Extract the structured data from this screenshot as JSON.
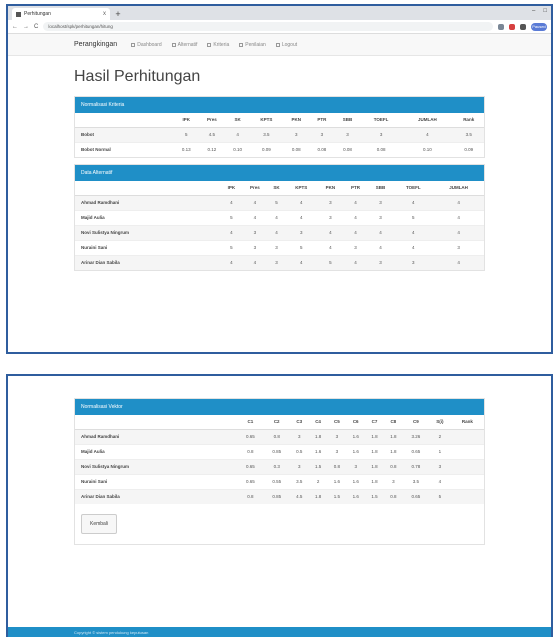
{
  "browser": {
    "tab_title": "Perhitungan",
    "tab_close": "x",
    "newtab": "+",
    "win_min": "–",
    "win_max": "□",
    "win_close": "×",
    "back": "←",
    "forward": "→",
    "reload": "C",
    "url": "localhost/spk/perhitungan/hitung",
    "profile": "Paused"
  },
  "nav": {
    "brand": "Perangkingan",
    "items": [
      "Dashboard",
      "Alternatif",
      "Kriteria",
      "Penilaian",
      "Logout"
    ]
  },
  "page_title": "Hasil Perhitungan",
  "table1": {
    "heading": "Normalisasi Kriteria",
    "columns": [
      "",
      "IPK",
      "Pres",
      "SK",
      "KPTS",
      "PKN",
      "PTR",
      "SBB",
      "TOEFL",
      "JUMLAH",
      "Rank"
    ],
    "rows": [
      [
        "Bobot",
        "5",
        "4.5",
        "4",
        "3.5",
        "3",
        "3",
        "3",
        "3",
        "4",
        "3.5"
      ],
      [
        "Bobot Normal",
        "0.13",
        "0.12",
        "0.10",
        "0.09",
        "0.08",
        "0.08",
        "0.08",
        "0.08",
        "0.10",
        "0.09"
      ]
    ]
  },
  "table2": {
    "heading": "Data Alternatif",
    "columns": [
      "",
      "IPK",
      "Pres",
      "SK",
      "KPTS",
      "PKN",
      "PTR",
      "SBB",
      "TOEFL",
      "JUMLAH"
    ],
    "rows": [
      [
        "Ahmad Ramdhani",
        "4",
        "4",
        "5",
        "4",
        "3",
        "4",
        "3",
        "4",
        "4"
      ],
      [
        "Majid Aulia",
        "5",
        "4",
        "4",
        "4",
        "3",
        "4",
        "3",
        "5",
        "4"
      ],
      [
        "Novi Sulistya Ningrum",
        "4",
        "3",
        "4",
        "3",
        "4",
        "4",
        "4",
        "4",
        "4"
      ],
      [
        "Nuraini Sani",
        "5",
        "3",
        "3",
        "5",
        "4",
        "3",
        "4",
        "4",
        "3"
      ],
      [
        "Arinar Dian Sabila",
        "4",
        "4",
        "3",
        "4",
        "5",
        "4",
        "3",
        "3",
        "4"
      ]
    ]
  },
  "table3": {
    "heading": "Normalisasi Vektor",
    "columns": [
      "",
      "C1",
      "C2",
      "C3",
      "C4",
      "C5",
      "C6",
      "C7",
      "C8",
      "C9",
      "S(i)",
      "Rank"
    ],
    "rows": [
      [
        "Ahmad Ramdhani",
        "0.65",
        "0.8",
        "3",
        "1.8",
        "3",
        "1.6",
        "1.8",
        "1.8",
        "3.26",
        "2",
        ""
      ],
      [
        "Majid Aulia",
        "0.8",
        "0.85",
        "0.5",
        "1.6",
        "3",
        "1.6",
        "1.8",
        "1.8",
        "0.65",
        "1",
        ""
      ],
      [
        "Novi Sulistya Ningrum",
        "0.65",
        "0.3",
        "3",
        "1.5",
        "0.8",
        "3",
        "1.8",
        "0.8",
        "0.78",
        "3",
        ""
      ],
      [
        "Nuraini Sani",
        "0.65",
        "0.55",
        "3.5",
        "2",
        "1.6",
        "1.6",
        "1.8",
        "3",
        "3.5",
        "4",
        ""
      ],
      [
        "Arinar Dian Sabila",
        "0.8",
        "0.85",
        "4.5",
        "1.8",
        "1.5",
        "1.6",
        "1.5",
        "0.8",
        "0.65",
        "5",
        ""
      ]
    ]
  },
  "back_button": "Kembali",
  "footer_text": "Copyright © sistem pendukung keputusan"
}
